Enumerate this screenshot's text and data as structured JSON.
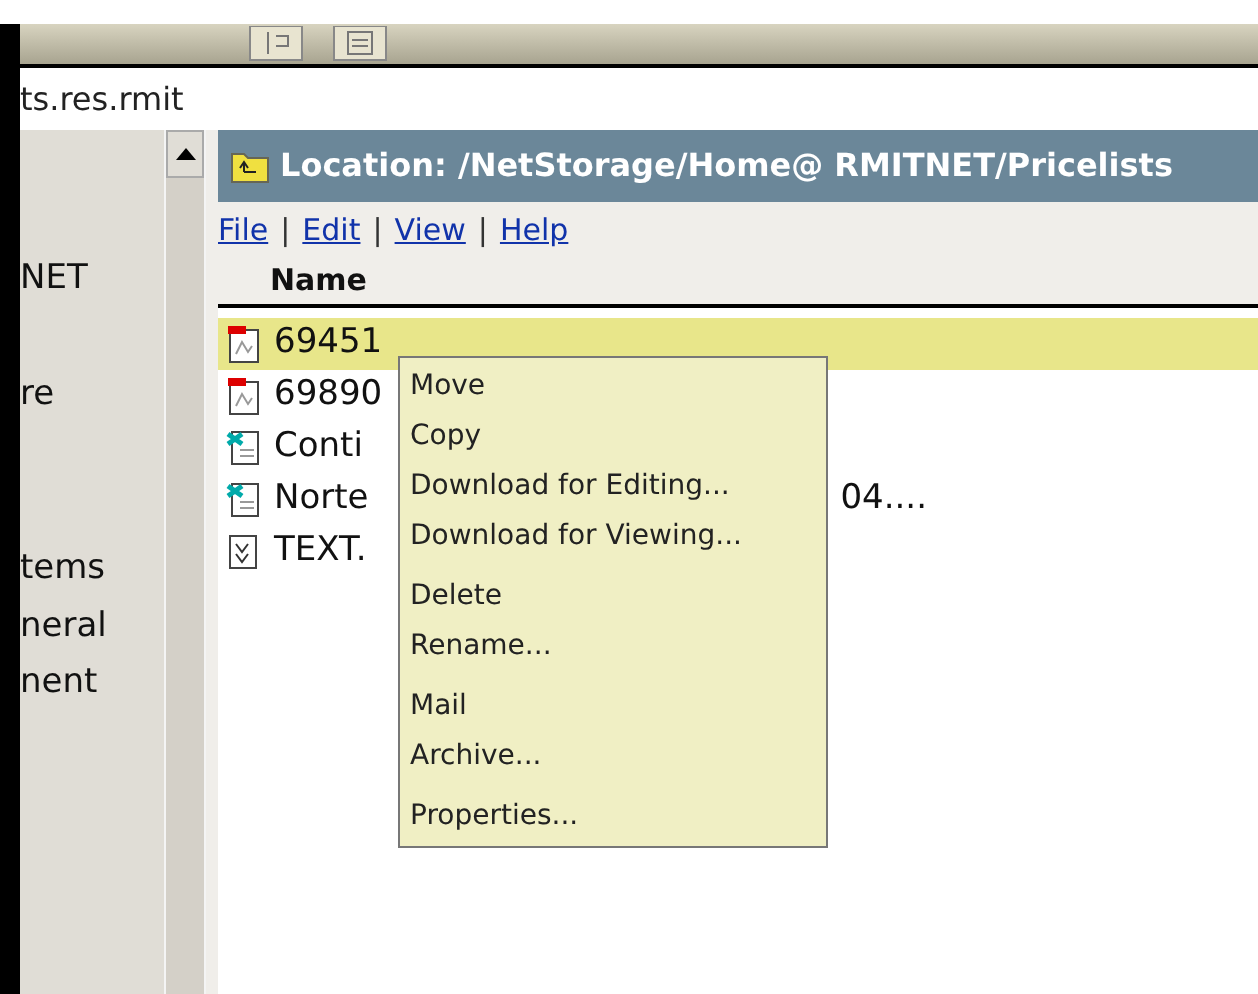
{
  "address": "ts.res.rmit",
  "sidebar": {
    "items": [
      {
        "label": "NET"
      },
      {
        "label": "re"
      },
      {
        "label": "tems"
      },
      {
        "label": "neral"
      },
      {
        "label": "nent"
      }
    ]
  },
  "location": {
    "label": "Location:",
    "path": "/NetStorage/Home@ RMITNET/Pricelists"
  },
  "menu": [
    {
      "label": "File"
    },
    {
      "label": "Edit"
    },
    {
      "label": "View"
    },
    {
      "label": "Help"
    }
  ],
  "separator": "|",
  "table": {
    "columns": [
      "Name"
    ],
    "rows": [
      {
        "kind": "pdf",
        "name": "69451",
        "selected": true
      },
      {
        "kind": "pdf",
        "name": "69890",
        "selected": false
      },
      {
        "kind": "sheet",
        "name": "Conti",
        "selected": false
      },
      {
        "kind": "sheet",
        "name": "Norte",
        "extra": "04....",
        "selected": false
      },
      {
        "kind": "text",
        "name": "TEXT.",
        "selected": false
      }
    ]
  },
  "context_menu": [
    [
      {
        "label": "Move"
      },
      {
        "label": "Copy"
      },
      {
        "label": "Download for Editing..."
      },
      {
        "label": "Download for Viewing..."
      }
    ],
    [
      {
        "label": "Delete"
      },
      {
        "label": "Rename..."
      }
    ],
    [
      {
        "label": "Mail"
      },
      {
        "label": "Archive..."
      }
    ],
    [
      {
        "label": "Properties..."
      }
    ]
  ]
}
